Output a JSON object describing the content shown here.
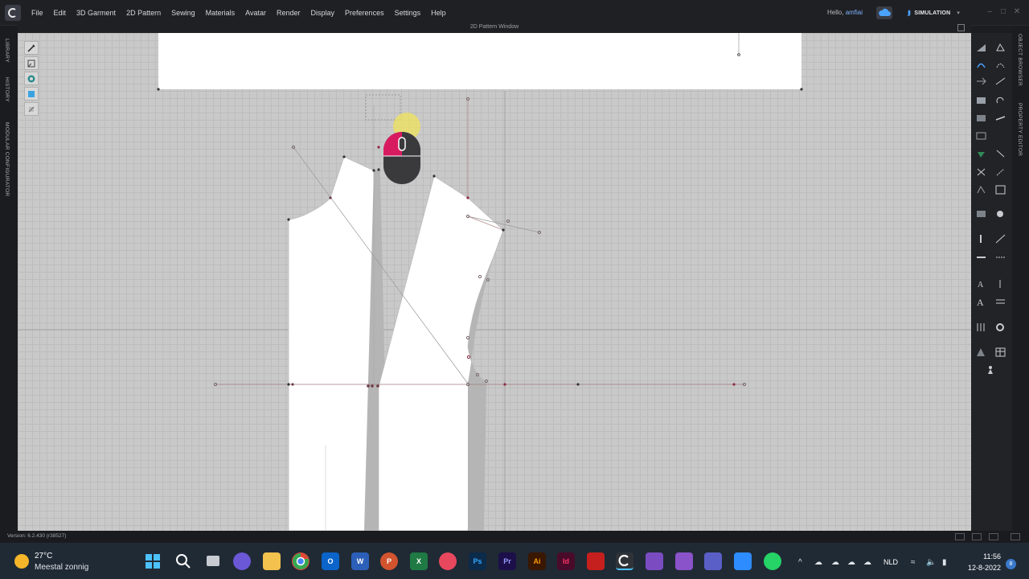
{
  "app": {
    "menus": [
      "File",
      "Edit",
      "3D Garment",
      "2D Pattern",
      "Sewing",
      "Materials",
      "Avatar",
      "Render",
      "Display",
      "Preferences",
      "Settings",
      "Help"
    ],
    "greeting": "Hello,",
    "user": "amfiai",
    "mode": "SIMULATION",
    "window_title": "2D Pattern Window",
    "version": "Version: 6.2.430 (r38527)",
    "left_tabs": [
      "LIBRARY",
      "HISTORY",
      "MODULAR CONFIGURATOR"
    ],
    "right_tabs": [
      "OBJECT BROWSER",
      "PROPERTY EDITOR"
    ]
  },
  "taskbar": {
    "weather_temp": "27°C",
    "weather_desc": "Meestal zonnig",
    "language": "NLD",
    "time": "11:56",
    "date": "12-8-2022",
    "notification_count": "8",
    "apps": [
      {
        "name": "start",
        "color": "#3b8eea",
        "glyph": ""
      },
      {
        "name": "search",
        "color": "#202a35",
        "glyph": ""
      },
      {
        "name": "task-view",
        "color": "#202a35",
        "glyph": ""
      },
      {
        "name": "chat",
        "color": "#6b58d6",
        "glyph": ""
      },
      {
        "name": "file-explorer",
        "color": "#f2c14e",
        "glyph": ""
      },
      {
        "name": "chrome",
        "color": "#e94235",
        "glyph": ""
      },
      {
        "name": "outlook",
        "color": "#0a64c9",
        "glyph": "O"
      },
      {
        "name": "word",
        "color": "#2b5fb8",
        "glyph": "W"
      },
      {
        "name": "powerpoint",
        "color": "#d2542e",
        "glyph": "P"
      },
      {
        "name": "excel",
        "color": "#1f7a44",
        "glyph": "X"
      },
      {
        "name": "creative-cloud",
        "color": "#e8485e",
        "glyph": ""
      },
      {
        "name": "photoshop",
        "color": "#0c2a4a",
        "glyph": "Ps"
      },
      {
        "name": "premiere",
        "color": "#1c0f4a",
        "glyph": "Pr"
      },
      {
        "name": "illustrator",
        "color": "#3a1700",
        "glyph": "Ai"
      },
      {
        "name": "indesign",
        "color": "#4a0b2a",
        "glyph": "Id"
      },
      {
        "name": "acrobat",
        "color": "#c5201d",
        "glyph": ""
      },
      {
        "name": "clo3d",
        "color": "#2f3338",
        "glyph": ""
      },
      {
        "name": "teams-meet",
        "color": "#7b4cc1",
        "glyph": ""
      },
      {
        "name": "teams-board",
        "color": "#8a53c9",
        "glyph": ""
      },
      {
        "name": "teams",
        "color": "#5a5fc7",
        "glyph": ""
      },
      {
        "name": "zoom",
        "color": "#2d8cff",
        "glyph": ""
      },
      {
        "name": "whatsapp",
        "color": "#25d366",
        "glyph": ""
      }
    ]
  }
}
